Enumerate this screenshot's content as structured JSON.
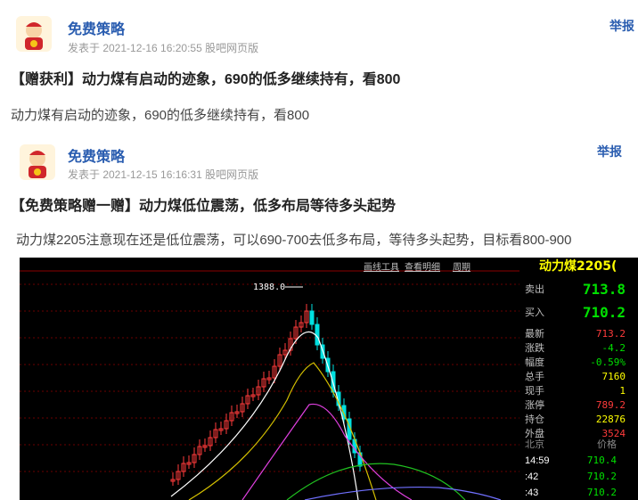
{
  "posts": [
    {
      "author": "免费策略",
      "meta": "发表于 2021-12-16 16:20:55 股吧网页版",
      "report": "举报",
      "title": "【赠获利】动力煤有启动的迹象，690的低多继续持有，看800",
      "body": "动力煤有启动的迹象，690的低多继续持有，看800"
    },
    {
      "author": "免费策略",
      "meta": "发表于 2021-12-15 16:16:31 股吧网页版",
      "report": "举报",
      "title": "【免费策略赠一赠】动力煤低位震荡，低多布局等待多头起势",
      "body": "动力煤2205注意现在还是低位震荡，可以690-700去低多布局，等待多头起势，目标看800-900"
    }
  ],
  "chart": {
    "toolbar": [
      "画线工具",
      "查看明细",
      "周期"
    ],
    "high_label": "1388.0",
    "contract": "动力煤2205(",
    "quote": {
      "sell_label": "卖出",
      "sell": "713.8",
      "buy_label": "买入",
      "buy": "710.2",
      "rows": [
        {
          "label": "最新",
          "value": "713.2",
          "color": "#ff3b3b"
        },
        {
          "label": "涨跌",
          "value": "-4.2",
          "color": "#00e000"
        },
        {
          "label": "幅度",
          "value": "-0.59%",
          "color": "#00e000"
        },
        {
          "label": "总手",
          "value": "7160",
          "color": "#ffff00"
        },
        {
          "label": "现手",
          "value": "1",
          "color": "#ffff00"
        },
        {
          "label": "涨停",
          "value": "789.2",
          "color": "#ff3b3b"
        },
        {
          "label": "持仓",
          "value": "22876",
          "color": "#ffff00"
        },
        {
          "label": "外盘",
          "value": "3524",
          "color": "#ff3b3b"
        }
      ],
      "ticks_header": {
        "place": "北京",
        "price": "价格"
      },
      "ticks": [
        {
          "time": "14:59",
          "price": "710.4"
        },
        {
          "time": ":42",
          "price": "710.2"
        },
        {
          "time": ":43",
          "price": "710.2"
        }
      ]
    }
  },
  "colors": {
    "link": "#2a5db0",
    "up": "#ff3b3b",
    "down": "#00e0e0"
  }
}
